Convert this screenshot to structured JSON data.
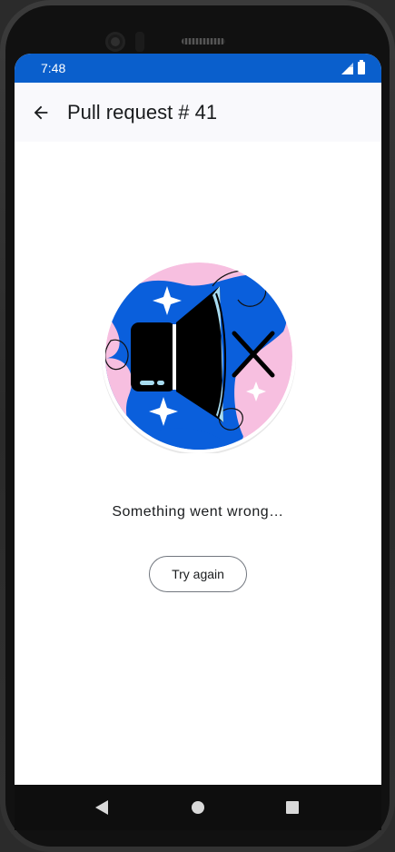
{
  "status_bar": {
    "time": "7:48",
    "icons": [
      "signal-icon",
      "battery-icon"
    ],
    "background_color": "#0a5fcc"
  },
  "app_bar": {
    "back_icon": "arrow-back-icon",
    "title": "Pull request # 41"
  },
  "error_state": {
    "illustration": "muted-speaker-illustration",
    "message": "Something went wrong…",
    "retry_label": "Try again"
  },
  "nav_bar": {
    "icons": [
      "nav-back-icon",
      "nav-home-icon",
      "nav-recents-icon"
    ]
  },
  "colors": {
    "accent_blue": "#0a5fcc",
    "illustration_pink": "#f7bfe0",
    "illustration_blue": "#0a5fdc"
  }
}
